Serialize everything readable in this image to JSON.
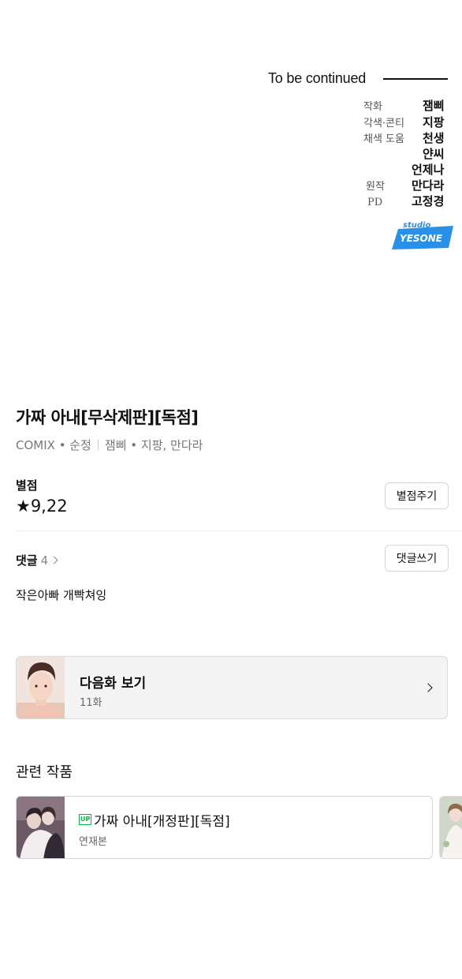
{
  "episode_end": {
    "to_be_continued": "To be continued",
    "credits": [
      {
        "role": "작화",
        "names": [
          "잼삐"
        ]
      },
      {
        "role": "각색·콘티",
        "names": [
          "지팡"
        ]
      },
      {
        "role": "채색 도움",
        "names": [
          "천생",
          "얀씨",
          "언제나"
        ]
      },
      {
        "role": "원작",
        "names": [
          "만다라"
        ]
      },
      {
        "role": "PD",
        "names": [
          "고정경"
        ]
      }
    ],
    "studio_logo": {
      "line1": "studio",
      "line2": "YESONE",
      "color": "#2a8fe6"
    }
  },
  "series": {
    "title": "가짜 아내[무삭제판][독점]",
    "genre": "COMIX • 순정",
    "authors": "잼삐 • 지팡, 만다라"
  },
  "rating": {
    "label": "별점",
    "value": "★9,22",
    "button": "별점주기"
  },
  "comments": {
    "label": "댓글",
    "count": "4",
    "button": "댓글쓰기",
    "top_comment": "작은아빠 개빡쳐잉"
  },
  "next_episode": {
    "title": "다음화 보기",
    "episode": "11화",
    "icon": "chevron-right-icon"
  },
  "related": {
    "title": "관련 작품",
    "items": [
      {
        "badge": "UP",
        "name": "가짜 아내[개정판][독점]",
        "status": "연재본"
      }
    ]
  },
  "colors": {
    "up_badge": "#00b843",
    "card_bg": "#f4f4f4",
    "text": "#111111"
  }
}
